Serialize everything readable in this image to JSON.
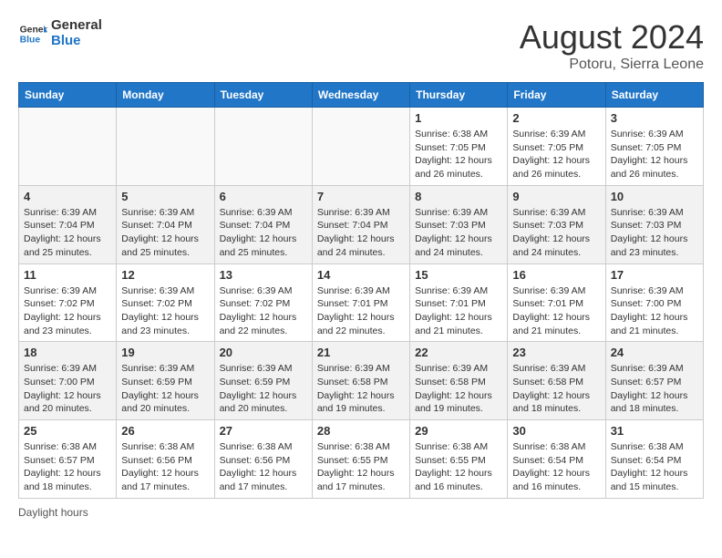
{
  "logo": {
    "text_general": "General",
    "text_blue": "Blue"
  },
  "title": "August 2024",
  "subtitle": "Potoru, Sierra Leone",
  "days_of_week": [
    "Sunday",
    "Monday",
    "Tuesday",
    "Wednesday",
    "Thursday",
    "Friday",
    "Saturday"
  ],
  "weeks": [
    [
      {
        "day": "",
        "info": ""
      },
      {
        "day": "",
        "info": ""
      },
      {
        "day": "",
        "info": ""
      },
      {
        "day": "",
        "info": ""
      },
      {
        "day": "1",
        "info": "Sunrise: 6:38 AM\nSunset: 7:05 PM\nDaylight: 12 hours and 26 minutes."
      },
      {
        "day": "2",
        "info": "Sunrise: 6:39 AM\nSunset: 7:05 PM\nDaylight: 12 hours and 26 minutes."
      },
      {
        "day": "3",
        "info": "Sunrise: 6:39 AM\nSunset: 7:05 PM\nDaylight: 12 hours and 26 minutes."
      }
    ],
    [
      {
        "day": "4",
        "info": "Sunrise: 6:39 AM\nSunset: 7:04 PM\nDaylight: 12 hours and 25 minutes."
      },
      {
        "day": "5",
        "info": "Sunrise: 6:39 AM\nSunset: 7:04 PM\nDaylight: 12 hours and 25 minutes."
      },
      {
        "day": "6",
        "info": "Sunrise: 6:39 AM\nSunset: 7:04 PM\nDaylight: 12 hours and 25 minutes."
      },
      {
        "day": "7",
        "info": "Sunrise: 6:39 AM\nSunset: 7:04 PM\nDaylight: 12 hours and 24 minutes."
      },
      {
        "day": "8",
        "info": "Sunrise: 6:39 AM\nSunset: 7:03 PM\nDaylight: 12 hours and 24 minutes."
      },
      {
        "day": "9",
        "info": "Sunrise: 6:39 AM\nSunset: 7:03 PM\nDaylight: 12 hours and 24 minutes."
      },
      {
        "day": "10",
        "info": "Sunrise: 6:39 AM\nSunset: 7:03 PM\nDaylight: 12 hours and 23 minutes."
      }
    ],
    [
      {
        "day": "11",
        "info": "Sunrise: 6:39 AM\nSunset: 7:02 PM\nDaylight: 12 hours and 23 minutes."
      },
      {
        "day": "12",
        "info": "Sunrise: 6:39 AM\nSunset: 7:02 PM\nDaylight: 12 hours and 23 minutes."
      },
      {
        "day": "13",
        "info": "Sunrise: 6:39 AM\nSunset: 7:02 PM\nDaylight: 12 hours and 22 minutes."
      },
      {
        "day": "14",
        "info": "Sunrise: 6:39 AM\nSunset: 7:01 PM\nDaylight: 12 hours and 22 minutes."
      },
      {
        "day": "15",
        "info": "Sunrise: 6:39 AM\nSunset: 7:01 PM\nDaylight: 12 hours and 21 minutes."
      },
      {
        "day": "16",
        "info": "Sunrise: 6:39 AM\nSunset: 7:01 PM\nDaylight: 12 hours and 21 minutes."
      },
      {
        "day": "17",
        "info": "Sunrise: 6:39 AM\nSunset: 7:00 PM\nDaylight: 12 hours and 21 minutes."
      }
    ],
    [
      {
        "day": "18",
        "info": "Sunrise: 6:39 AM\nSunset: 7:00 PM\nDaylight: 12 hours and 20 minutes."
      },
      {
        "day": "19",
        "info": "Sunrise: 6:39 AM\nSunset: 6:59 PM\nDaylight: 12 hours and 20 minutes."
      },
      {
        "day": "20",
        "info": "Sunrise: 6:39 AM\nSunset: 6:59 PM\nDaylight: 12 hours and 20 minutes."
      },
      {
        "day": "21",
        "info": "Sunrise: 6:39 AM\nSunset: 6:58 PM\nDaylight: 12 hours and 19 minutes."
      },
      {
        "day": "22",
        "info": "Sunrise: 6:39 AM\nSunset: 6:58 PM\nDaylight: 12 hours and 19 minutes."
      },
      {
        "day": "23",
        "info": "Sunrise: 6:39 AM\nSunset: 6:58 PM\nDaylight: 12 hours and 18 minutes."
      },
      {
        "day": "24",
        "info": "Sunrise: 6:39 AM\nSunset: 6:57 PM\nDaylight: 12 hours and 18 minutes."
      }
    ],
    [
      {
        "day": "25",
        "info": "Sunrise: 6:38 AM\nSunset: 6:57 PM\nDaylight: 12 hours and 18 minutes."
      },
      {
        "day": "26",
        "info": "Sunrise: 6:38 AM\nSunset: 6:56 PM\nDaylight: 12 hours and 17 minutes."
      },
      {
        "day": "27",
        "info": "Sunrise: 6:38 AM\nSunset: 6:56 PM\nDaylight: 12 hours and 17 minutes."
      },
      {
        "day": "28",
        "info": "Sunrise: 6:38 AM\nSunset: 6:55 PM\nDaylight: 12 hours and 17 minutes."
      },
      {
        "day": "29",
        "info": "Sunrise: 6:38 AM\nSunset: 6:55 PM\nDaylight: 12 hours and 16 minutes."
      },
      {
        "day": "30",
        "info": "Sunrise: 6:38 AM\nSunset: 6:54 PM\nDaylight: 12 hours and 16 minutes."
      },
      {
        "day": "31",
        "info": "Sunrise: 6:38 AM\nSunset: 6:54 PM\nDaylight: 12 hours and 15 minutes."
      }
    ]
  ],
  "footer": "Daylight hours"
}
